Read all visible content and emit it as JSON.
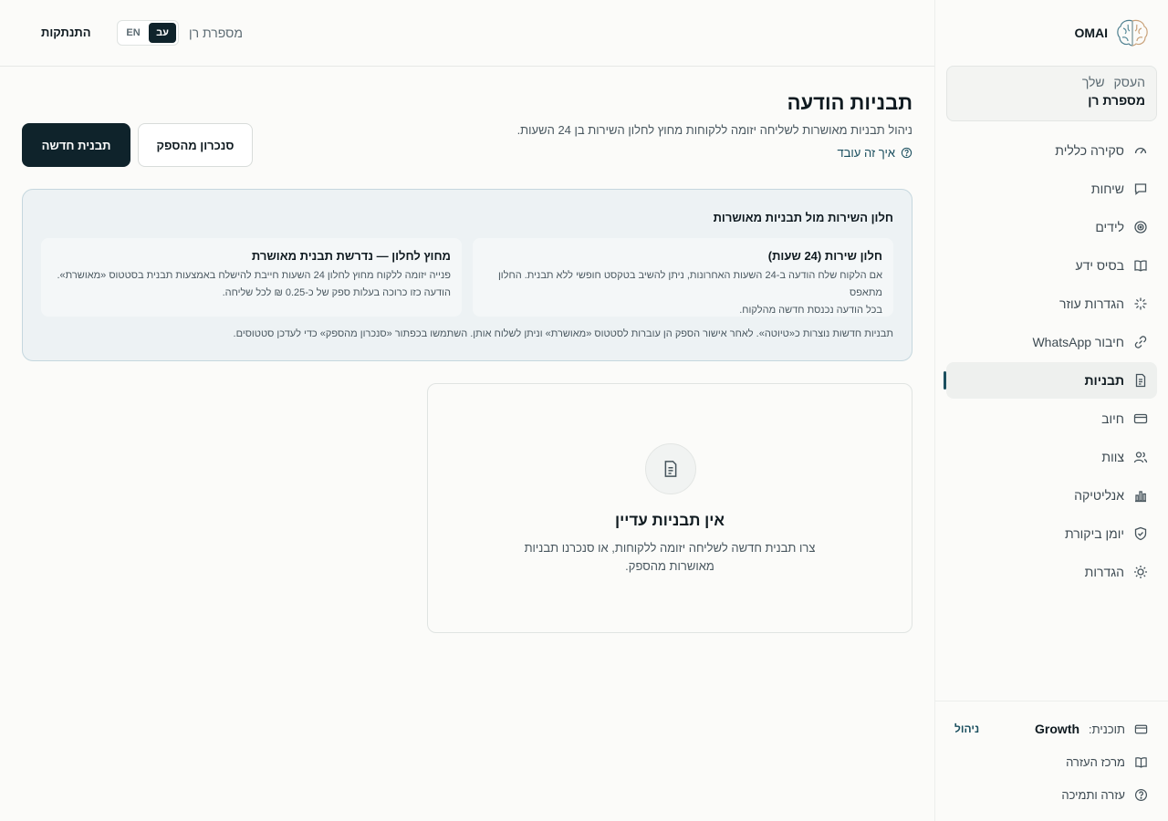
{
  "brand": {
    "name": "OMAI",
    "icon": "brain-icon"
  },
  "sidebar": {
    "business_label": "העסק שלך",
    "business_name": "מספרת רן",
    "items": [
      {
        "label": "סקירה כללית",
        "icon": "gauge-icon"
      },
      {
        "label": "שיחות",
        "icon": "chat-icon"
      },
      {
        "label": "לידים",
        "icon": "target-icon"
      },
      {
        "label": "בסיס ידע",
        "icon": "book-icon"
      },
      {
        "label": "הגדרות עוזר",
        "icon": "sparkle-icon"
      },
      {
        "label": "חיבור WhatsApp",
        "icon": "link-icon"
      },
      {
        "label": "תבניות",
        "icon": "document-icon",
        "active": true
      },
      {
        "label": "חיוב",
        "icon": "credit-card-icon"
      },
      {
        "label": "צוות",
        "icon": "users-icon"
      },
      {
        "label": "אנליטיקה",
        "icon": "bar-chart-icon"
      },
      {
        "label": "יומן ביקורת",
        "icon": "shield-icon"
      },
      {
        "label": "הגדרות",
        "icon": "sun-gear-icon"
      }
    ],
    "bottom": {
      "plan_label": "תוכנית:",
      "plan_name": "Growth",
      "manage": "ניהול",
      "help_center": "מרכז העזרה",
      "support": "עזרה ותמיכה"
    }
  },
  "header": {
    "logout": "התנתקות",
    "lang_en": "EN",
    "lang_he": "עב",
    "business_name": "מספרת רן"
  },
  "main": {
    "title": "תבניות הודעה",
    "subtitle": "ניהול תבניות מאושרות לשליחה יזומה ללקוחות מחוץ לחלון השירות בן 24 השעות.",
    "howto": "איך זה עובד",
    "new_template": "תבנית חדשה",
    "sync_provider": "סנכרון מהספק",
    "info": {
      "title": "חלון השירות מול תבניות מאושרות",
      "card1_title": "חלון שירות (24 שעות)",
      "card1_line1": "אם הלקוח שלח הודעה ב-24 השעות האחרונות, ניתן להשיב בטקסט חופשי ללא תבנית. החלון מתאפס",
      "card1_line2": "בכל הודעה נכנסת חדשה מהלקוח.",
      "card2_title": "מחוץ לחלון — נדרשת תבנית מאושרת",
      "card2_line1": "פנייה יזומה ללקוח מחוץ לחלון 24 השעות חייבת להישלח באמצעות תבנית בסטטוס «מאושרת».",
      "card2_line2": "הודעה כזו כרוכה בעלות ספק של כ-0.25 ₪ לכל שליחה.",
      "note": "תבניות חדשות נוצרות כ«טיוטה». לאחר אישור הספק הן עוברות לסטטוס «מאושרת» וניתן לשלוח אותן. השתמשו בכפתור «סנכרון מהספק» כדי לעדכן סטטוסים."
    },
    "empty": {
      "title": "אין תבניות עדיין",
      "text": "צרו תבנית חדשה לשליחה יזומה ללקוחות, או סנכרנו תבניות מאושרות מהספק."
    }
  },
  "colors": {
    "primary": "#0f232b",
    "accent": "#1b4f5f",
    "info_bg": "#edf2f4",
    "background": "#fbfbf9"
  }
}
